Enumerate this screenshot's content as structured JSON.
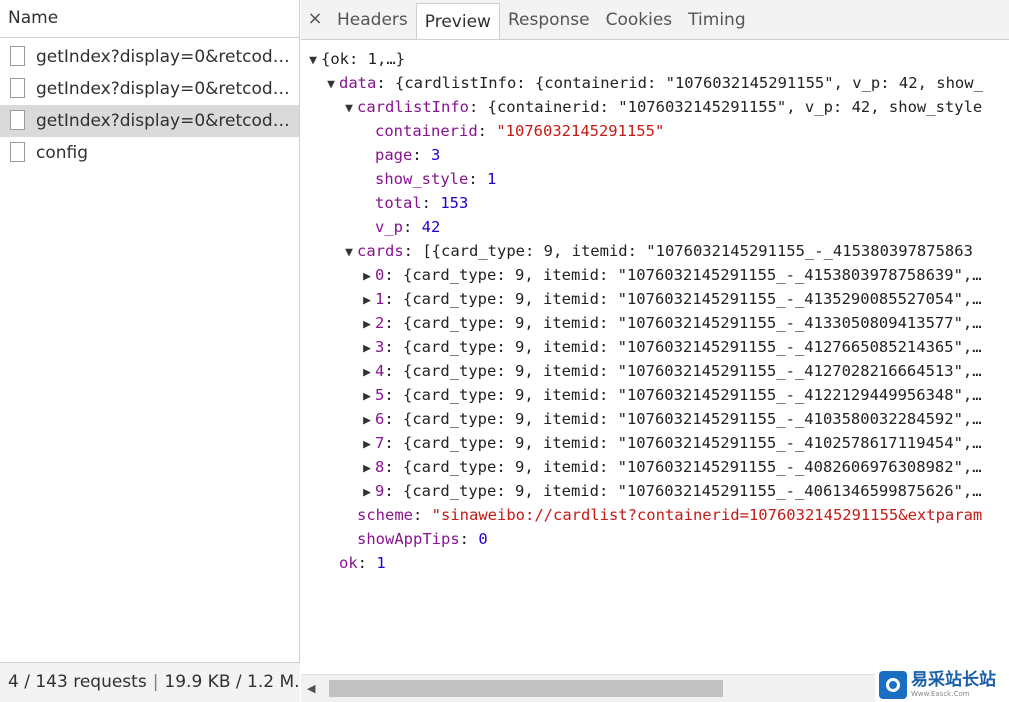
{
  "left_panel": {
    "header": "Name",
    "requests": [
      {
        "name": "getIndex?display=0&retcode=...",
        "selected": false
      },
      {
        "name": "getIndex?display=0&retcode=...",
        "selected": false
      },
      {
        "name": "getIndex?display=0&retcode=...",
        "selected": true
      },
      {
        "name": "config",
        "selected": false
      }
    ],
    "status": {
      "requests": "4 / 143 requests",
      "separator": "|",
      "size": "19.9 KB / 1.2 M..."
    }
  },
  "tabs": {
    "close_icon": "×",
    "items": [
      "Headers",
      "Preview",
      "Response",
      "Cookies",
      "Timing"
    ],
    "active": "Preview"
  },
  "json_preview": {
    "lines": [
      {
        "indent": 0,
        "tri": "▼",
        "parts": [
          {
            "t": "{ok: 1,…}",
            "c": "plain"
          }
        ]
      },
      {
        "indent": 1,
        "tri": "▼",
        "parts": [
          {
            "t": "data",
            "c": "key"
          },
          {
            "t": ": {cardlistInfo: {containerid: \"1076032145291155\", v_p: 42, show_",
            "c": "plain"
          }
        ]
      },
      {
        "indent": 2,
        "tri": "▼",
        "parts": [
          {
            "t": "cardlistInfo",
            "c": "key"
          },
          {
            "t": ": {containerid: \"1076032145291155\", v_p: 42, show_style",
            "c": "plain"
          }
        ]
      },
      {
        "indent": 3,
        "tri": "",
        "parts": [
          {
            "t": "containerid",
            "c": "key"
          },
          {
            "t": ": ",
            "c": "plain"
          },
          {
            "t": "\"1076032145291155\"",
            "c": "str"
          }
        ]
      },
      {
        "indent": 3,
        "tri": "",
        "parts": [
          {
            "t": "page",
            "c": "key"
          },
          {
            "t": ": ",
            "c": "plain"
          },
          {
            "t": "3",
            "c": "num"
          }
        ]
      },
      {
        "indent": 3,
        "tri": "",
        "parts": [
          {
            "t": "show_style",
            "c": "key"
          },
          {
            "t": ": ",
            "c": "plain"
          },
          {
            "t": "1",
            "c": "num"
          }
        ]
      },
      {
        "indent": 3,
        "tri": "",
        "parts": [
          {
            "t": "total",
            "c": "key"
          },
          {
            "t": ": ",
            "c": "plain"
          },
          {
            "t": "153",
            "c": "num"
          }
        ]
      },
      {
        "indent": 3,
        "tri": "",
        "parts": [
          {
            "t": "v_p",
            "c": "key"
          },
          {
            "t": ": ",
            "c": "plain"
          },
          {
            "t": "42",
            "c": "num"
          }
        ]
      },
      {
        "indent": 2,
        "tri": "▼",
        "parts": [
          {
            "t": "cards",
            "c": "key"
          },
          {
            "t": ": [{card_type: 9, itemid: \"1076032145291155_-_415380397875863",
            "c": "plain"
          }
        ]
      },
      {
        "indent": 3,
        "tri": "▶",
        "parts": [
          {
            "t": "0",
            "c": "key"
          },
          {
            "t": ": {card_type: 9, itemid: \"1076032145291155_-_4153803978758639\",…",
            "c": "plain"
          }
        ]
      },
      {
        "indent": 3,
        "tri": "▶",
        "parts": [
          {
            "t": "1",
            "c": "key"
          },
          {
            "t": ": {card_type: 9, itemid: \"1076032145291155_-_4135290085527054\",…",
            "c": "plain"
          }
        ]
      },
      {
        "indent": 3,
        "tri": "▶",
        "parts": [
          {
            "t": "2",
            "c": "key"
          },
          {
            "t": ": {card_type: 9, itemid: \"1076032145291155_-_4133050809413577\",…",
            "c": "plain"
          }
        ]
      },
      {
        "indent": 3,
        "tri": "▶",
        "parts": [
          {
            "t": "3",
            "c": "key"
          },
          {
            "t": ": {card_type: 9, itemid: \"1076032145291155_-_4127665085214365\",…",
            "c": "plain"
          }
        ]
      },
      {
        "indent": 3,
        "tri": "▶",
        "parts": [
          {
            "t": "4",
            "c": "key"
          },
          {
            "t": ": {card_type: 9, itemid: \"1076032145291155_-_4127028216664513\",…",
            "c": "plain"
          }
        ]
      },
      {
        "indent": 3,
        "tri": "▶",
        "parts": [
          {
            "t": "5",
            "c": "key"
          },
          {
            "t": ": {card_type: 9, itemid: \"1076032145291155_-_4122129449956348\",…",
            "c": "plain"
          }
        ]
      },
      {
        "indent": 3,
        "tri": "▶",
        "parts": [
          {
            "t": "6",
            "c": "key"
          },
          {
            "t": ": {card_type: 9, itemid: \"1076032145291155_-_4103580032284592\",…",
            "c": "plain"
          }
        ]
      },
      {
        "indent": 3,
        "tri": "▶",
        "parts": [
          {
            "t": "7",
            "c": "key"
          },
          {
            "t": ": {card_type: 9, itemid: \"1076032145291155_-_4102578617119454\",…",
            "c": "plain"
          }
        ]
      },
      {
        "indent": 3,
        "tri": "▶",
        "parts": [
          {
            "t": "8",
            "c": "key"
          },
          {
            "t": ": {card_type: 9, itemid: \"1076032145291155_-_4082606976308982\",…",
            "c": "plain"
          }
        ]
      },
      {
        "indent": 3,
        "tri": "▶",
        "parts": [
          {
            "t": "9",
            "c": "key"
          },
          {
            "t": ": {card_type: 9, itemid: \"1076032145291155_-_4061346599875626\",…",
            "c": "plain"
          }
        ]
      },
      {
        "indent": 2,
        "tri": "",
        "parts": [
          {
            "t": "scheme",
            "c": "key"
          },
          {
            "t": ": ",
            "c": "plain"
          },
          {
            "t": "\"sinaweibo://cardlist?containerid=1076032145291155&extparam",
            "c": "str"
          }
        ]
      },
      {
        "indent": 2,
        "tri": "",
        "parts": [
          {
            "t": "showAppTips",
            "c": "key"
          },
          {
            "t": ": ",
            "c": "plain"
          },
          {
            "t": "0",
            "c": "num"
          }
        ]
      },
      {
        "indent": 1,
        "tri": "",
        "parts": [
          {
            "t": "ok",
            "c": "key"
          },
          {
            "t": ": ",
            "c": "plain"
          },
          {
            "t": "1",
            "c": "num"
          }
        ]
      }
    ]
  },
  "scrollbar": {
    "left_arrow": "◀",
    "thumb_fraction": 0.58
  },
  "watermark": {
    "text_cn": "易采站长站",
    "text_en": "Www.Easck.Com"
  },
  "colors": {
    "key": "#881391",
    "string": "#c41a16",
    "number": "#1c00cf",
    "selected_row": "#dadada"
  }
}
